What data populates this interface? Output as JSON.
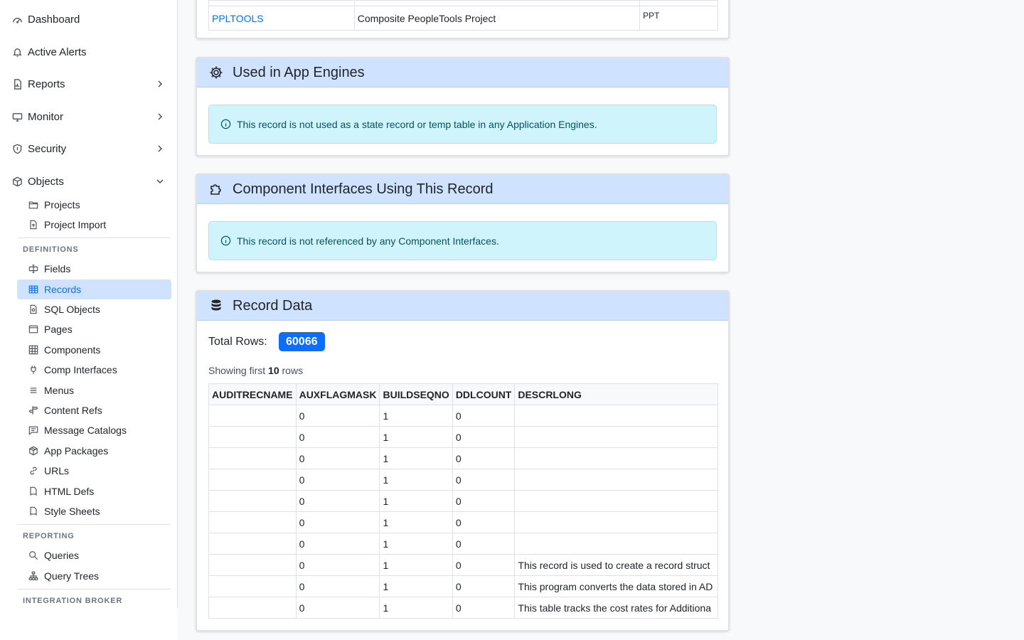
{
  "sidebar": {
    "top": [
      {
        "label": "Dashboard",
        "icon": "dashboard-icon"
      },
      {
        "label": "Active Alerts",
        "icon": "bell-icon"
      },
      {
        "label": "Reports",
        "icon": "report-icon"
      },
      {
        "label": "Monitor",
        "icon": "monitor-icon"
      },
      {
        "label": "Security",
        "icon": "shield-icon"
      },
      {
        "label": "Objects",
        "icon": "box-icon"
      }
    ],
    "objects_items": [
      {
        "label": "Projects",
        "icon": "folder-icon"
      },
      {
        "label": "Project Import",
        "icon": "file-import-icon"
      }
    ],
    "definitions_label": "DEFINITIONS",
    "definitions_items": [
      {
        "label": "Fields",
        "icon": "input-cursor-icon"
      },
      {
        "label": "Records",
        "icon": "table-icon"
      },
      {
        "label": "SQL Objects",
        "icon": "file-code-icon"
      },
      {
        "label": "Pages",
        "icon": "window-icon"
      },
      {
        "label": "Components",
        "icon": "grid-icon"
      },
      {
        "label": "Comp Interfaces",
        "icon": "plug-icon"
      },
      {
        "label": "Menus",
        "icon": "list-icon"
      },
      {
        "label": "Content Refs",
        "icon": "signpost-icon"
      },
      {
        "label": "Message Catalogs",
        "icon": "chat-text-icon"
      },
      {
        "label": "App Packages",
        "icon": "package-icon"
      },
      {
        "label": "URLs",
        "icon": "link-icon"
      },
      {
        "label": "HTML Defs",
        "icon": "file-html-icon"
      },
      {
        "label": "Style Sheets",
        "icon": "file-css-icon"
      }
    ],
    "reporting_label": "REPORTING",
    "reporting_items": [
      {
        "label": "Queries",
        "icon": "search-icon"
      },
      {
        "label": "Query Trees",
        "icon": "tree-icon"
      }
    ],
    "integration_label": "INTEGRATION BROKER"
  },
  "projects_table": {
    "row": {
      "name": "PPLTOOLS",
      "description": "Composite PeopleTools Project",
      "type": "PPT"
    }
  },
  "app_engines": {
    "title": "Used in App Engines",
    "message": "This record is not used as a state record or temp table in any Application Engines."
  },
  "comp_interfaces": {
    "title": "Component Interfaces Using This Record",
    "message": "This record is not referenced by any Component Interfaces."
  },
  "record_data": {
    "title": "Record Data",
    "total_label": "Total Rows:",
    "total_rows": "60066",
    "showing_prefix": "Showing first",
    "showing_count": "10",
    "showing_suffix": "rows",
    "columns": [
      "AUDITRECNAME",
      "AUXFLAGMASK",
      "BUILDSEQNO",
      "DDLCOUNT",
      "DESCRLONG"
    ],
    "rows": [
      [
        "",
        "0",
        "1",
        "0",
        ""
      ],
      [
        "",
        "0",
        "1",
        "0",
        ""
      ],
      [
        "",
        "0",
        "1",
        "0",
        ""
      ],
      [
        "",
        "0",
        "1",
        "0",
        ""
      ],
      [
        "",
        "0",
        "1",
        "0",
        ""
      ],
      [
        "",
        "0",
        "1",
        "0",
        ""
      ],
      [
        "",
        "0",
        "1",
        "0",
        ""
      ],
      [
        "",
        "0",
        "1",
        "0",
        "This record is used to create a record struct"
      ],
      [
        "",
        "0",
        "1",
        "0",
        "This program converts the data stored in AD"
      ],
      [
        "",
        "0",
        "1",
        "0",
        "This table tracks the cost rates for Additiona"
      ]
    ]
  }
}
